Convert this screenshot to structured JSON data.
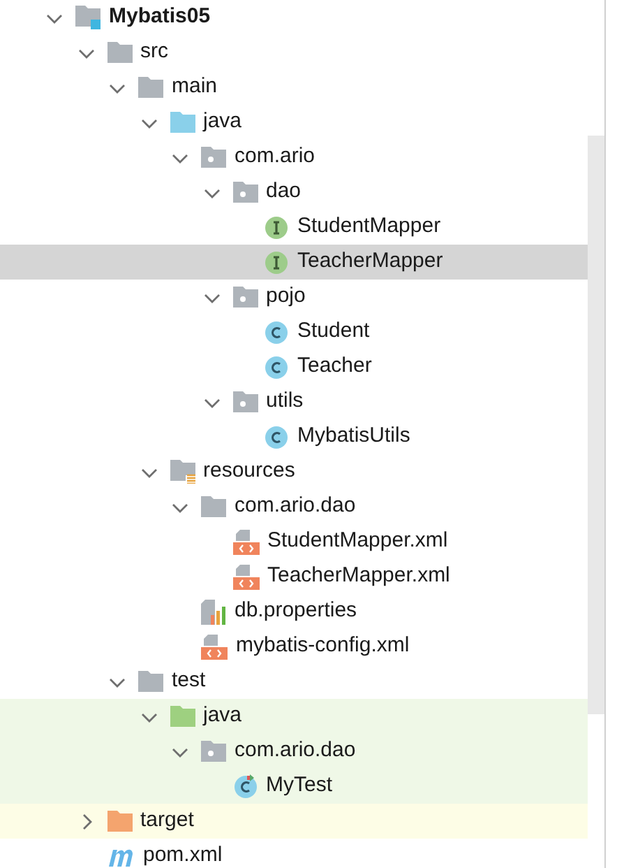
{
  "tree": [
    {
      "label": "Mybatis05",
      "kind": "module",
      "expanded": true,
      "selected": false,
      "children": [
        {
          "label": "src",
          "kind": "folder",
          "expanded": true,
          "selected": false,
          "children": [
            {
              "label": "main",
              "kind": "folder",
              "expanded": true,
              "selected": false,
              "children": [
                {
                  "label": "java",
                  "kind": "source-root",
                  "expanded": true,
                  "selected": false,
                  "children": [
                    {
                      "label": "com.ario",
                      "kind": "package",
                      "expanded": true,
                      "selected": false,
                      "children": [
                        {
                          "label": "dao",
                          "kind": "package",
                          "expanded": true,
                          "selected": false,
                          "children": [
                            {
                              "label": "StudentMapper",
                              "kind": "interface",
                              "selected": false
                            },
                            {
                              "label": "TeacherMapper",
                              "kind": "interface",
                              "selected": true
                            }
                          ]
                        },
                        {
                          "label": "pojo",
                          "kind": "package",
                          "expanded": true,
                          "selected": false,
                          "children": [
                            {
                              "label": "Student",
                              "kind": "class",
                              "selected": false
                            },
                            {
                              "label": "Teacher",
                              "kind": "class",
                              "selected": false
                            }
                          ]
                        },
                        {
                          "label": "utils",
                          "kind": "package",
                          "expanded": true,
                          "selected": false,
                          "children": [
                            {
                              "label": "MybatisUtils",
                              "kind": "class",
                              "selected": false
                            }
                          ]
                        }
                      ]
                    }
                  ]
                },
                {
                  "label": "resources",
                  "kind": "resources",
                  "expanded": true,
                  "selected": false,
                  "children": [
                    {
                      "label": "com.ario.dao",
                      "kind": "folder",
                      "expanded": true,
                      "selected": false,
                      "children": [
                        {
                          "label": "StudentMapper.xml",
                          "kind": "xml",
                          "selected": false
                        },
                        {
                          "label": "TeacherMapper.xml",
                          "kind": "xml",
                          "selected": false
                        }
                      ]
                    },
                    {
                      "label": "db.properties",
                      "kind": "properties",
                      "selected": false
                    },
                    {
                      "label": "mybatis-config.xml",
                      "kind": "xml",
                      "selected": false
                    }
                  ]
                }
              ]
            },
            {
              "label": "test",
              "kind": "folder",
              "expanded": true,
              "selected": false,
              "children": [
                {
                  "label": "java",
                  "kind": "test-root",
                  "color": "#eff8e7",
                  "expanded": true,
                  "selected": false,
                  "children": [
                    {
                      "label": "com.ario.dao",
                      "kind": "package",
                      "color": "#eff8e7",
                      "expanded": true,
                      "selected": false,
                      "children": [
                        {
                          "label": "MyTest",
                          "kind": "test-class",
                          "color": "#eff8e7",
                          "selected": false
                        }
                      ]
                    }
                  ]
                }
              ]
            }
          ]
        },
        {
          "label": "target",
          "kind": "excluded",
          "color": "#fdfde6",
          "expanded": false,
          "selected": false
        },
        {
          "label": "pom.xml",
          "kind": "maven",
          "selected": false
        }
      ]
    }
  ]
}
